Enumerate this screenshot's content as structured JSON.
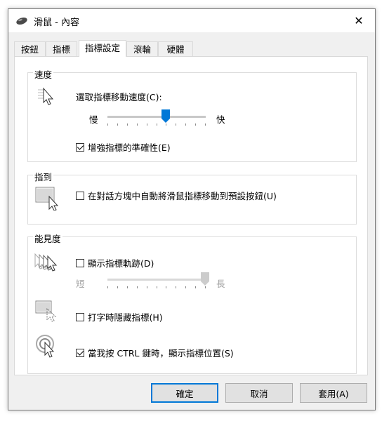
{
  "window": {
    "title": "滑鼠 - 內容",
    "close_glyph": "✕"
  },
  "tabs": [
    {
      "label": "按鈕",
      "active": false
    },
    {
      "label": "指標",
      "active": false
    },
    {
      "label": "指標設定",
      "active": true
    },
    {
      "label": "滾輪",
      "active": false
    },
    {
      "label": "硬體",
      "active": false
    }
  ],
  "speed": {
    "group_title": "速度",
    "label": "選取指標移動速度(C):",
    "slow": "慢",
    "fast": "快",
    "slider_value": 6,
    "slider_max": 10,
    "enhance_label": "增強指標的準確性(E)",
    "enhance_checked": true,
    "icon": "pointer-speed-icon"
  },
  "snap": {
    "group_title": "指到",
    "label": "在對話方塊中自動將滑鼠指標移動到預設按鈕(U)",
    "checked": false,
    "icon": "snap-to-icon"
  },
  "visibility": {
    "group_title": "能見度",
    "trails_label": "顯示指標軌跡(D)",
    "trails_checked": false,
    "trails_short": "短",
    "trails_long": "長",
    "trails_value": 10,
    "trails_max": 10,
    "hide_label": "打字時隱藏指標(H)",
    "hide_checked": false,
    "ctrl_label": "當我按 CTRL 鍵時，顯示指標位置(S)",
    "ctrl_checked": true
  },
  "buttons": {
    "ok": "確定",
    "cancel": "取消",
    "apply": "套用(A)"
  },
  "colors": {
    "accent": "#0078d7"
  }
}
